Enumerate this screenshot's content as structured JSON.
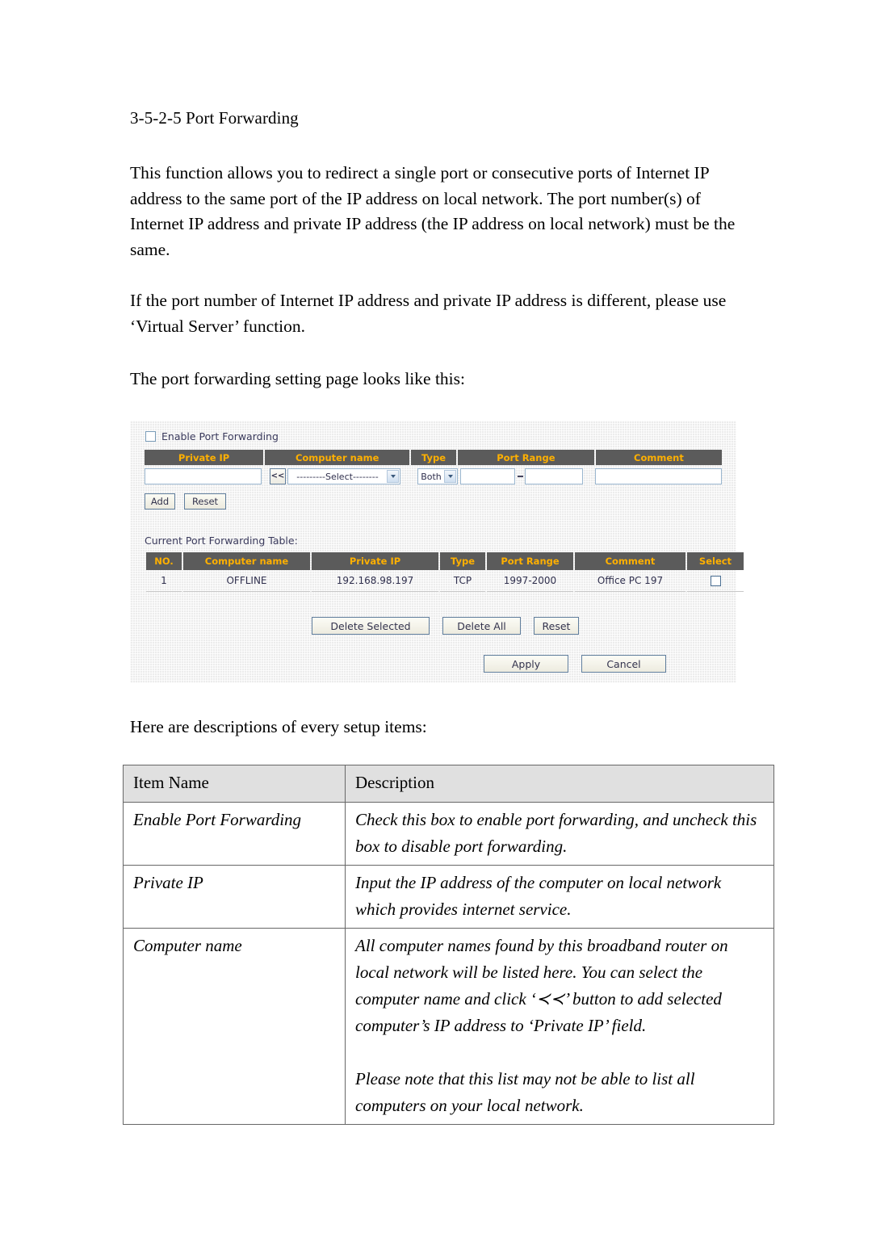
{
  "document": {
    "heading": "3-5-2-5 Port Forwarding",
    "paragraph1": "This function allows you to redirect a single port or consecutive ports of Internet IP address to the same port of the IP address on local network. The port number(s) of Internet IP address and private IP address (the IP address on local network) must be the same.",
    "paragraph2": "If the port number of Internet IP address and private IP address is different, please use ‘Virtual Server’ function.",
    "paragraph3": "The port forwarding setting page looks like this:",
    "caption": "Here are descriptions of every setup items:"
  },
  "router_ui": {
    "enable_checkbox_label": "Enable Port Forwarding",
    "enable_checkbox_checked": false,
    "form_headers": [
      "Private IP",
      "Computer name",
      "Type",
      "Port Range",
      "Comment"
    ],
    "form_fields": {
      "private_ip_value": "",
      "private_ip_placeholder": "",
      "back_button_label": "<<",
      "computer_name_selected": "---------Select--------",
      "type_selected": "Both",
      "port_start_value": "",
      "port_end_value": "",
      "port_separator": "-",
      "comment_value": ""
    },
    "form_buttons": {
      "add": "Add",
      "reset": "Reset"
    },
    "table_label": "Current Port Forwarding Table:",
    "table_headers": [
      "NO.",
      "Computer name",
      "Private IP",
      "Type",
      "Port Range",
      "Comment",
      "Select"
    ],
    "table_rows": [
      {
        "no": "1",
        "computer_name": "OFFLINE",
        "private_ip": "192.168.98.197",
        "type": "TCP",
        "port_range": "1997-2000",
        "comment": "Office PC 197",
        "selected": false
      }
    ],
    "table_buttons": {
      "delete_selected": "Delete Selected",
      "delete_all": "Delete All",
      "reset": "Reset"
    },
    "page_buttons": {
      "apply": "Apply",
      "cancel": "Cancel"
    },
    "colors": {
      "header_background": "#5b5b5b",
      "header_text": "#ffb000",
      "panel_background": "#ececec",
      "input_border": "#9ab6cf",
      "button_border": "#5f7d9c",
      "body_text": "#2f2f4d"
    }
  },
  "description_table": {
    "headers": [
      "Item Name",
      "Description"
    ],
    "rows": [
      {
        "item": "Enable Port Forwarding",
        "description": "Check this box to enable port forwarding, and uncheck this box to disable port forwarding."
      },
      {
        "item": "Private IP",
        "description": "Input the IP address of the computer on local network which provides internet service."
      },
      {
        "item": "Computer name",
        "description_part1": "All computer names found by this broadband router on local network will be listed here. You can select the computer name and click ‘≺≺’ button to add selected computer’s IP address to ‘Private IP’ field.",
        "description_part2": "Please note that this list may not be able to list all computers on your local network."
      }
    ]
  }
}
